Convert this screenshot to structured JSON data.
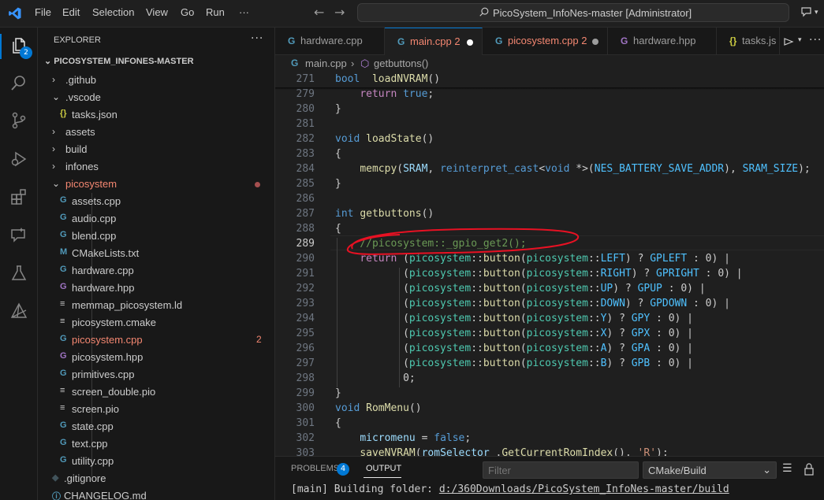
{
  "titlebar": {
    "menu": [
      "File",
      "Edit",
      "Selection",
      "View",
      "Go",
      "Run",
      "···"
    ],
    "search_text": "PicoSystem_InfoNes-master [Administrator]"
  },
  "activity": {
    "explorer_badge": "2"
  },
  "explorer": {
    "title": "EXPLORER",
    "more": "···",
    "root": "PICOSYSTEM_INFONES-MASTER",
    "tree": [
      {
        "label": ".github",
        "type": "folder",
        "expanded": false,
        "depth": 1
      },
      {
        "label": ".vscode",
        "type": "folder",
        "expanded": true,
        "depth": 1
      },
      {
        "label": "tasks.json",
        "type": "json",
        "depth": 2
      },
      {
        "label": "assets",
        "type": "folder",
        "expanded": false,
        "depth": 1
      },
      {
        "label": "build",
        "type": "folder",
        "expanded": false,
        "depth": 1
      },
      {
        "label": "infones",
        "type": "folder",
        "expanded": false,
        "depth": 1
      },
      {
        "label": "picosystem",
        "type": "folder",
        "expanded": true,
        "depth": 1,
        "modified": true
      },
      {
        "label": "assets.cpp",
        "type": "cpp",
        "depth": 2
      },
      {
        "label": "audio.cpp",
        "type": "cpp",
        "depth": 2
      },
      {
        "label": "blend.cpp",
        "type": "cpp",
        "depth": 2
      },
      {
        "label": "CMakeLists.txt",
        "type": "cmake",
        "depth": 2
      },
      {
        "label": "hardware.cpp",
        "type": "cpp",
        "depth": 2
      },
      {
        "label": "hardware.hpp",
        "type": "hpp",
        "depth": 2
      },
      {
        "label": "memmap_picosystem.ld",
        "type": "ld",
        "depth": 2
      },
      {
        "label": "picosystem.cmake",
        "type": "ld",
        "depth": 2
      },
      {
        "label": "picosystem.cpp",
        "type": "cpp",
        "depth": 2,
        "errors": "2"
      },
      {
        "label": "picosystem.hpp",
        "type": "hpp",
        "depth": 2
      },
      {
        "label": "primitives.cpp",
        "type": "cpp",
        "depth": 2
      },
      {
        "label": "screen_double.pio",
        "type": "ld",
        "depth": 2
      },
      {
        "label": "screen.pio",
        "type": "ld",
        "depth": 2
      },
      {
        "label": "state.cpp",
        "type": "cpp",
        "depth": 2
      },
      {
        "label": "text.cpp",
        "type": "cpp",
        "depth": 2
      },
      {
        "label": "utility.cpp",
        "type": "cpp",
        "depth": 2
      },
      {
        "label": ".gitignore",
        "type": "git",
        "depth": 1
      },
      {
        "label": "CHANGELOG.md",
        "type": "md",
        "depth": 1
      }
    ]
  },
  "tabs": [
    {
      "label": "hardware.cpp",
      "icon": "cpp",
      "active": false
    },
    {
      "label": "main.cpp",
      "count": "2",
      "icon": "cpp",
      "active": true,
      "dirty": true
    },
    {
      "label": "picosystem.cpp",
      "count": "2",
      "icon": "cpp",
      "active": false,
      "dirty": true
    },
    {
      "label": "hardware.hpp",
      "icon": "hpp",
      "active": false
    },
    {
      "label": "tasks.js",
      "icon": "json",
      "active": false
    }
  ],
  "breadcrumb": {
    "file": "main.cpp",
    "symbol": "getbuttons()"
  },
  "editor": {
    "current_line": "289",
    "lines": [
      {
        "n": "271",
        "tokens": [
          [
            "kw",
            "bool"
          ],
          [
            "",
            "  "
          ],
          [
            "fn",
            "loadNVRAM"
          ],
          [
            "",
            "()"
          ]
        ]
      },
      {
        "n": "279",
        "tokens": [
          [
            "",
            "    "
          ],
          [
            "ctl",
            "return"
          ],
          [
            "",
            " "
          ],
          [
            "kw",
            "true"
          ],
          [
            "",
            ";"
          ]
        ]
      },
      {
        "n": "280",
        "tokens": [
          [
            "",
            "}"
          ]
        ]
      },
      {
        "n": "281",
        "tokens": []
      },
      {
        "n": "282",
        "tokens": [
          [
            "kw",
            "void"
          ],
          [
            "",
            " "
          ],
          [
            "fn",
            "loadState"
          ],
          [
            "",
            "()"
          ]
        ]
      },
      {
        "n": "283",
        "tokens": [
          [
            "",
            "{"
          ]
        ]
      },
      {
        "n": "284",
        "tokens": [
          [
            "",
            "    "
          ],
          [
            "fn",
            "memcpy"
          ],
          [
            "",
            "("
          ],
          [
            "var",
            "SRAM"
          ],
          [
            "",
            ", "
          ],
          [
            "kw",
            "reinterpret_cast"
          ],
          [
            "",
            "<"
          ],
          [
            "kw",
            "void"
          ],
          [
            "",
            " *>("
          ],
          [
            "con",
            "NES_BATTERY_SAVE_ADDR"
          ],
          [
            "",
            "), "
          ],
          [
            "con",
            "SRAM_SIZE"
          ],
          [
            "",
            ");"
          ]
        ]
      },
      {
        "n": "285",
        "tokens": [
          [
            "",
            "}"
          ]
        ]
      },
      {
        "n": "286",
        "tokens": []
      },
      {
        "n": "287",
        "tokens": [
          [
            "kw",
            "int"
          ],
          [
            "",
            " "
          ],
          [
            "fn",
            "getbuttons"
          ],
          [
            "",
            "()"
          ]
        ]
      },
      {
        "n": "288",
        "tokens": [
          [
            "",
            "{"
          ]
        ]
      },
      {
        "n": "289",
        "tokens": [
          [
            "",
            "    "
          ],
          [
            "cm",
            "//picosystem::_gpio_get2();"
          ]
        ]
      },
      {
        "n": "290",
        "tokens": [
          [
            "",
            "    "
          ],
          [
            "ctl",
            "return"
          ],
          [
            "",
            " ("
          ],
          [
            "ty",
            "picosystem"
          ],
          [
            "",
            "::"
          ],
          [
            "fn",
            "button"
          ],
          [
            "",
            "("
          ],
          [
            "ty",
            "picosystem"
          ],
          [
            "",
            "::"
          ],
          [
            "con",
            "LEFT"
          ],
          [
            "",
            ") ? "
          ],
          [
            "con",
            "GPLEFT"
          ],
          [
            "",
            " : 0) |"
          ]
        ]
      },
      {
        "n": "291",
        "tokens": [
          [
            "",
            "           ("
          ],
          [
            "ty",
            "picosystem"
          ],
          [
            "",
            "::"
          ],
          [
            "fn",
            "button"
          ],
          [
            "",
            "("
          ],
          [
            "ty",
            "picosystem"
          ],
          [
            "",
            "::"
          ],
          [
            "con",
            "RIGHT"
          ],
          [
            "",
            ") ? "
          ],
          [
            "con",
            "GPRIGHT"
          ],
          [
            "",
            " : 0) |"
          ]
        ]
      },
      {
        "n": "292",
        "tokens": [
          [
            "",
            "           ("
          ],
          [
            "ty",
            "picosystem"
          ],
          [
            "",
            "::"
          ],
          [
            "fn",
            "button"
          ],
          [
            "",
            "("
          ],
          [
            "ty",
            "picosystem"
          ],
          [
            "",
            "::"
          ],
          [
            "con",
            "UP"
          ],
          [
            "",
            ") ? "
          ],
          [
            "con",
            "GPUP"
          ],
          [
            "",
            " : 0) |"
          ]
        ]
      },
      {
        "n": "293",
        "tokens": [
          [
            "",
            "           ("
          ],
          [
            "ty",
            "picosystem"
          ],
          [
            "",
            "::"
          ],
          [
            "fn",
            "button"
          ],
          [
            "",
            "("
          ],
          [
            "ty",
            "picosystem"
          ],
          [
            "",
            "::"
          ],
          [
            "con",
            "DOWN"
          ],
          [
            "",
            ") ? "
          ],
          [
            "con",
            "GPDOWN"
          ],
          [
            "",
            " : 0) |"
          ]
        ]
      },
      {
        "n": "294",
        "tokens": [
          [
            "",
            "           ("
          ],
          [
            "ty",
            "picosystem"
          ],
          [
            "",
            "::"
          ],
          [
            "fn",
            "button"
          ],
          [
            "",
            "("
          ],
          [
            "ty",
            "picosystem"
          ],
          [
            "",
            "::"
          ],
          [
            "con",
            "Y"
          ],
          [
            "",
            ") ? "
          ],
          [
            "con",
            "GPY"
          ],
          [
            "",
            " : 0) |"
          ]
        ]
      },
      {
        "n": "295",
        "tokens": [
          [
            "",
            "           ("
          ],
          [
            "ty",
            "picosystem"
          ],
          [
            "",
            "::"
          ],
          [
            "fn",
            "button"
          ],
          [
            "",
            "("
          ],
          [
            "ty",
            "picosystem"
          ],
          [
            "",
            "::"
          ],
          [
            "con",
            "X"
          ],
          [
            "",
            ") ? "
          ],
          [
            "con",
            "GPX"
          ],
          [
            "",
            " : 0) |"
          ]
        ]
      },
      {
        "n": "296",
        "tokens": [
          [
            "",
            "           ("
          ],
          [
            "ty",
            "picosystem"
          ],
          [
            "",
            "::"
          ],
          [
            "fn",
            "button"
          ],
          [
            "",
            "("
          ],
          [
            "ty",
            "picosystem"
          ],
          [
            "",
            "::"
          ],
          [
            "con",
            "A"
          ],
          [
            "",
            ") ? "
          ],
          [
            "con",
            "GPA"
          ],
          [
            "",
            " : 0) |"
          ]
        ]
      },
      {
        "n": "297",
        "tokens": [
          [
            "",
            "           ("
          ],
          [
            "ty",
            "picosystem"
          ],
          [
            "",
            "::"
          ],
          [
            "fn",
            "button"
          ],
          [
            "",
            "("
          ],
          [
            "ty",
            "picosystem"
          ],
          [
            "",
            "::"
          ],
          [
            "con",
            "B"
          ],
          [
            "",
            ") ? "
          ],
          [
            "con",
            "GPB"
          ],
          [
            "",
            " : 0) |"
          ]
        ]
      },
      {
        "n": "298",
        "tokens": [
          [
            "",
            "           0;"
          ]
        ]
      },
      {
        "n": "299",
        "tokens": [
          [
            "",
            "}"
          ]
        ]
      },
      {
        "n": "300",
        "tokens": [
          [
            "kw",
            "void"
          ],
          [
            "",
            " "
          ],
          [
            "fn",
            "RomMenu"
          ],
          [
            "",
            "()"
          ]
        ]
      },
      {
        "n": "301",
        "tokens": [
          [
            "",
            "{"
          ]
        ]
      },
      {
        "n": "302",
        "tokens": [
          [
            "",
            "    "
          ],
          [
            "var",
            "micromenu"
          ],
          [
            "",
            " = "
          ],
          [
            "kw",
            "false"
          ],
          [
            "",
            ";"
          ]
        ]
      },
      {
        "n": "303",
        "tokens": [
          [
            "",
            "    "
          ],
          [
            "fn",
            "saveNVRAM"
          ],
          [
            "",
            "("
          ],
          [
            "var",
            "romSelector_"
          ],
          [
            "",
            "."
          ],
          [
            "fn",
            "GetCurrentRomIndex"
          ],
          [
            "",
            "(), "
          ],
          [
            "str",
            "'R'"
          ],
          [
            "",
            ");"
          ]
        ]
      }
    ]
  },
  "panel": {
    "tabs": [
      {
        "label": "PROBLEMS",
        "badge": "4"
      },
      {
        "label": "OUTPUT",
        "active": true
      }
    ],
    "filter_placeholder": "Filter",
    "channel": "CMake/Build",
    "output_prefix": "[main] Building folder: ",
    "output_path": "d:/360Downloads/PicoSystem_InfoNes-master/build"
  },
  "colors": {
    "accent": "#0078d4",
    "error": "#f48771",
    "annotation": "#e81123"
  }
}
